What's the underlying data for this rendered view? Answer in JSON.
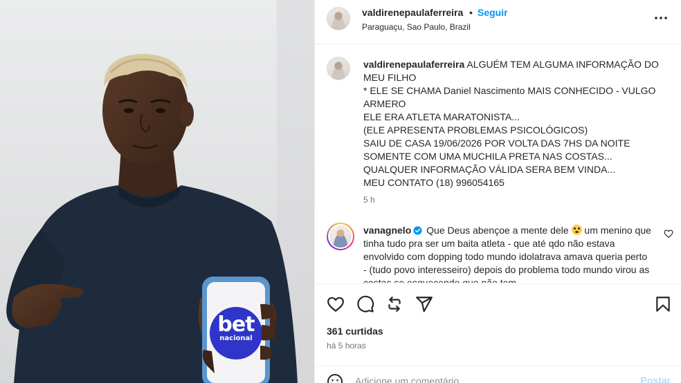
{
  "post": {
    "username": "valdirenepaulaferreira",
    "dot": "•",
    "follow_label": "Seguir",
    "location": "Paraguaçu, Sao Paulo, Brazil",
    "more_icon": "more-horizontal-icon"
  },
  "photo": {
    "phone_logo_line1": "bet",
    "phone_logo_line2": "nacional",
    "colors": {
      "background": "#e3e4e5",
      "shirt": "#1d2a3b",
      "phone_case": "#5b95cf",
      "logo": "#2e35c8"
    }
  },
  "caption": {
    "username": "valdirenepaulaferreira",
    "first": "ALGUÉM TEM ALGUMA INFORMAÇÃO DO MEU FILHO",
    "lines": [
      "* ELE SE CHAMA Daniel Nascimento MAIS CONHECIDO - VULGO ARMERO",
      "ELE ERA ATLETA MARATONISTA...",
      "(ELE APRESENTA PROBLEMAS PSICOLÓGICOS)",
      "SAIU DE CASA 19/06/2026 POR VOLTA DAS 7HS DA NOITE",
      "SOMENTE COM UMA MUCHILA PRETA NAS COSTAS...",
      "QUALQUER INFORMAÇÃO VÁLIDA SERA BEM VINDA...",
      "MEU CONTATO (18) 996054165"
    ],
    "time": "5 h"
  },
  "comment": {
    "username": "vanagnelo",
    "text_before_emoji": "Que Deus abençoe a mente dele",
    "text_after_emoji": " um menino que tinha tudo pra ser um baita atleta - que até qdo não estava envolvido com dopping todo mundo idolatrava amava queria perto - (tudo povo interesseiro) depois do problema todo mundo virou as costas se esquecendo que não tem",
    "verified_icon": "verified-badge-icon",
    "emoji_icon": "flushed-face-emoji-icon",
    "like_icon": "heart-outline-icon"
  },
  "actions": {
    "icons": [
      "heart-outline-icon",
      "comment-bubble-icon",
      "repost-icon",
      "share-plane-icon",
      "bookmark-icon"
    ],
    "likes": "361 curtidas",
    "ago": "há 5 horas"
  },
  "add_comment": {
    "placeholder": "Adicione um comentário...",
    "post_label": "Postar",
    "emoji_icon": "smiley-icon"
  },
  "colors": {
    "link_blue": "#0095f6",
    "post_disabled": "#b2dffc",
    "text": "#262626",
    "muted": "#737373"
  }
}
